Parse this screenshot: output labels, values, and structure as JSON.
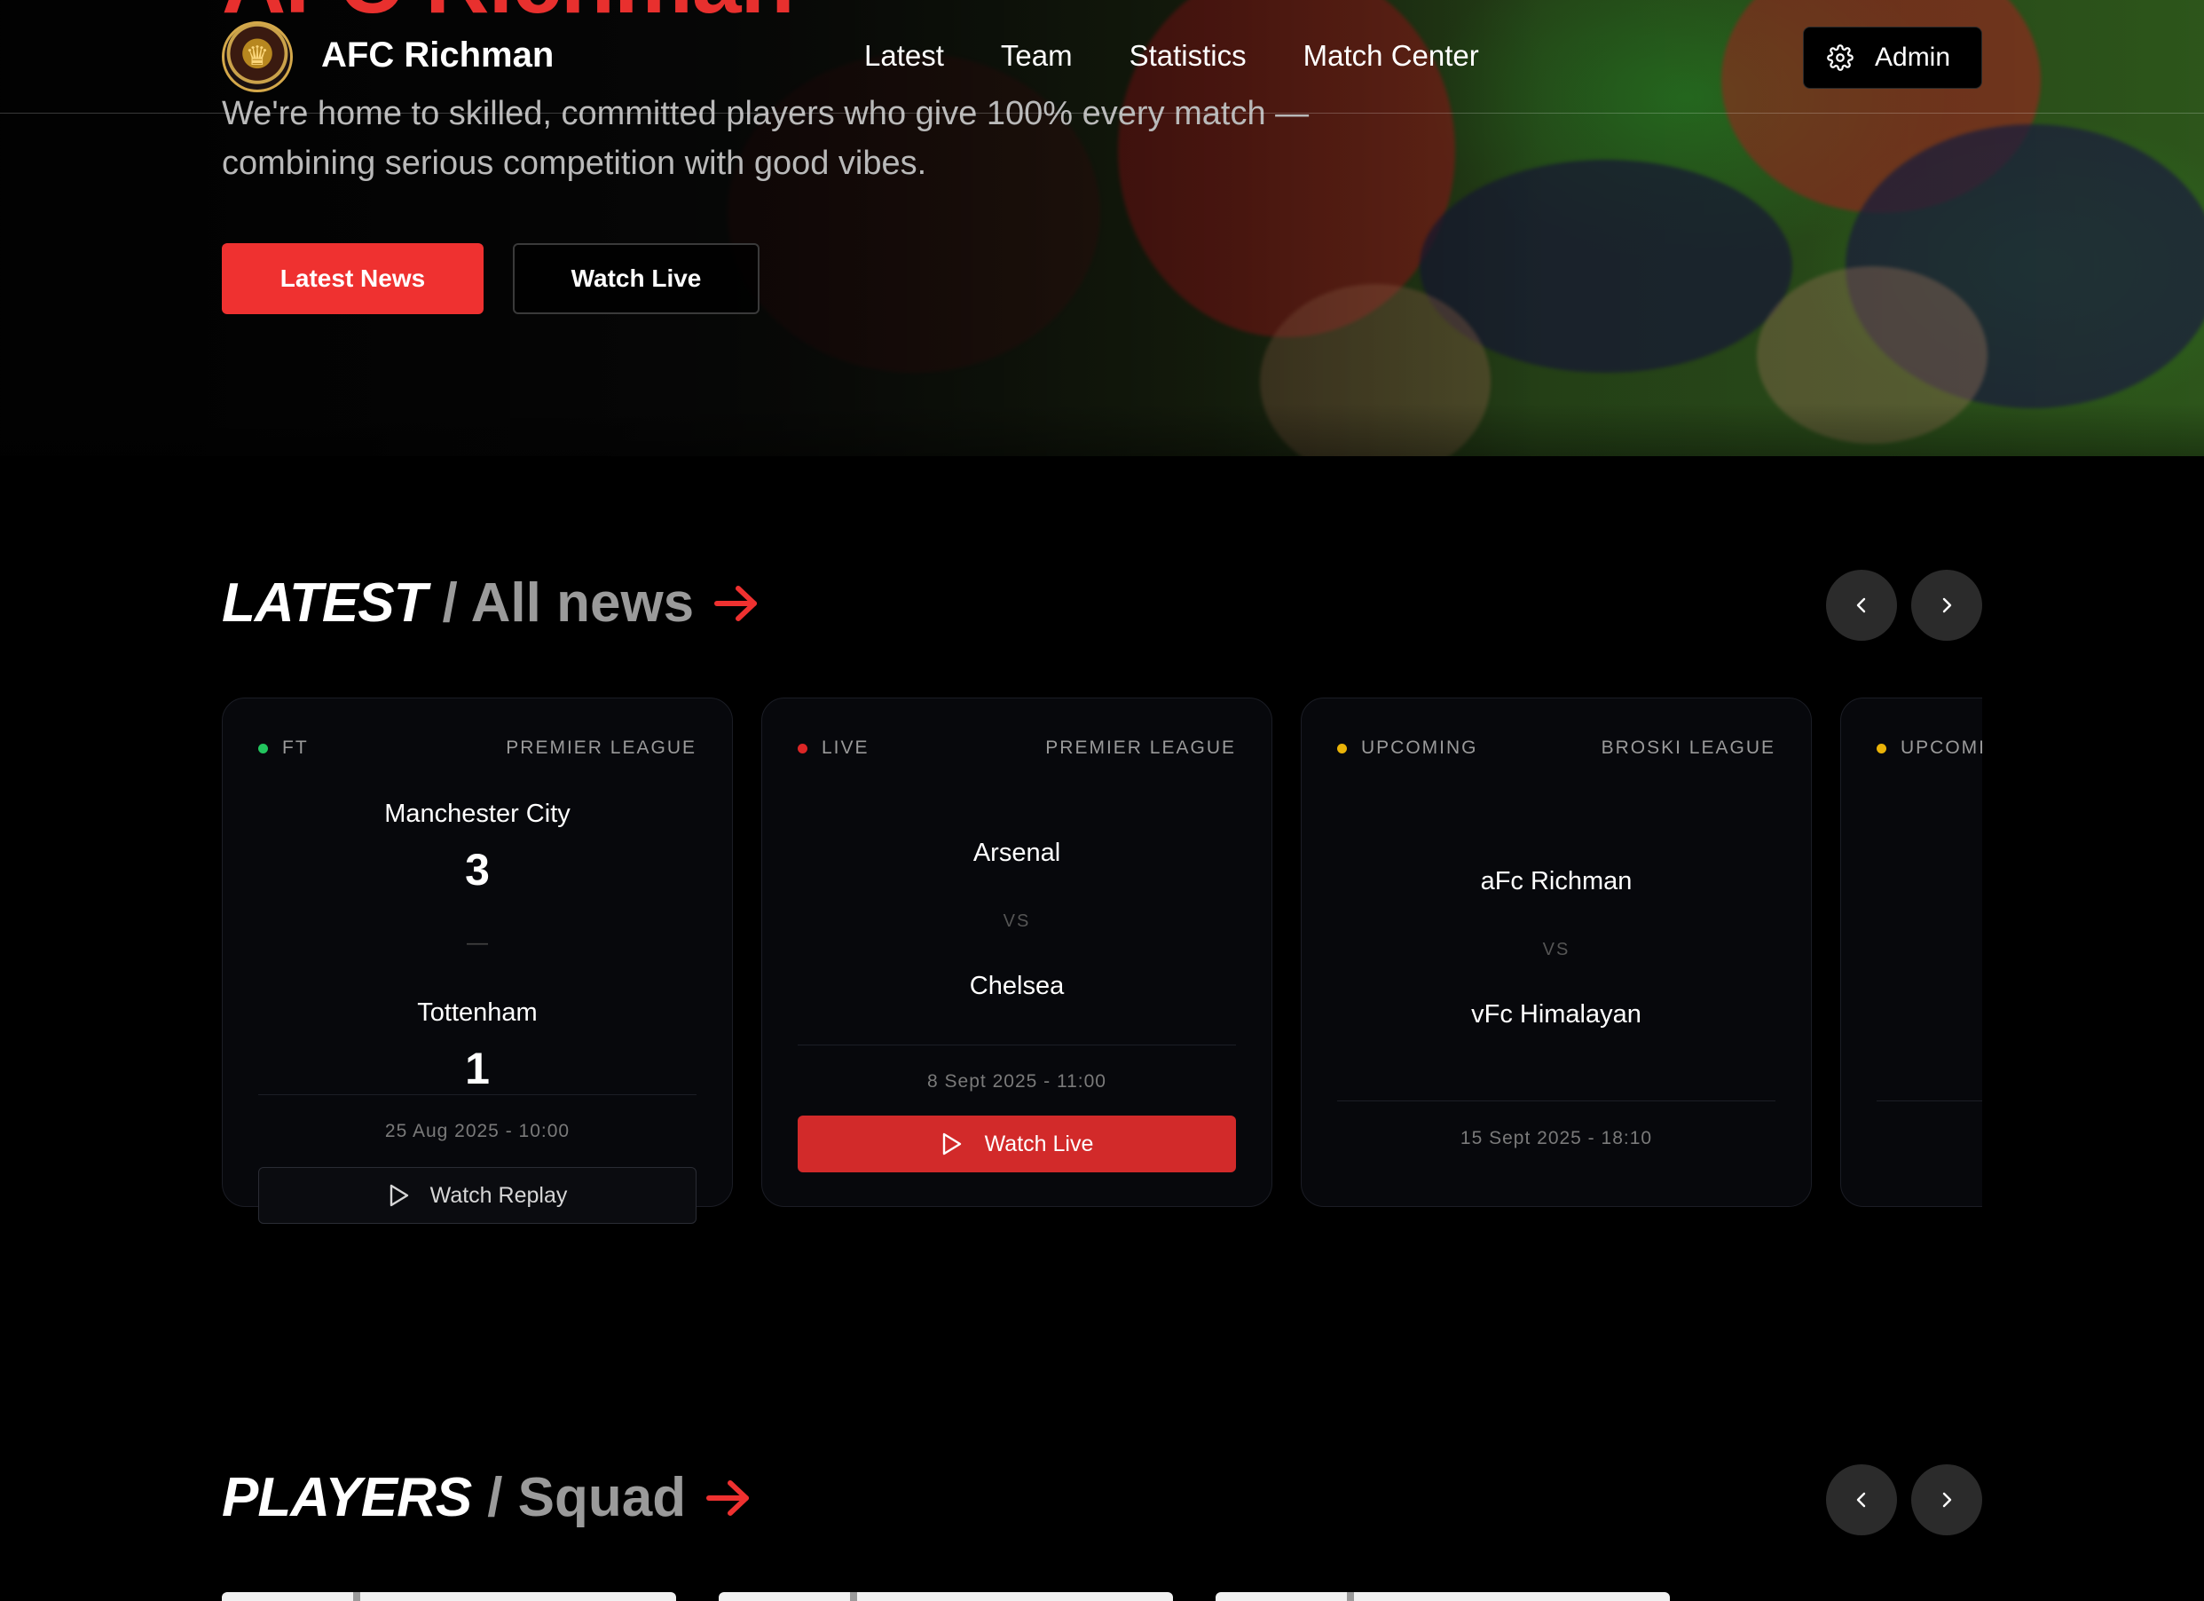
{
  "hero": {
    "title": "AFC Richman",
    "description": "We're home to skilled, committed players who give 100% every match — combining serious competition with good vibes.",
    "primary_button": "Latest News",
    "secondary_button": "Watch Live"
  },
  "nav": {
    "brand": "AFC Richman",
    "links": [
      "Latest",
      "Team",
      "Statistics",
      "Match Center"
    ],
    "admin_label": "Admin"
  },
  "latest": {
    "heading_bold": "LATEST",
    "heading_muted": "/ All news"
  },
  "matches": [
    {
      "status": "FT",
      "status_color": "#22c55e",
      "league": "PREMIER LEAGUE",
      "home": "Manchester City",
      "home_score": "3",
      "separator": "—",
      "away": "Tottenham",
      "away_score": "1",
      "date": "25 Aug 2025 - 10:00",
      "action": "Watch Replay"
    },
    {
      "status": "LIVE",
      "status_color": "#dc2626",
      "league": "PREMIER LEAGUE",
      "home": "Arsenal",
      "vs": "VS",
      "away": "Chelsea",
      "date": "8 Sept 2025 - 11:00",
      "action": "Watch Live"
    },
    {
      "status": "UPCOMING",
      "status_color": "#eab308",
      "league": "BROSKI LEAGUE",
      "home": "aFc Richman",
      "vs": "VS",
      "away": "vFc Himalayan",
      "date": "15 Sept 2025 - 18:10"
    },
    {
      "status": "UPCOMING",
      "status_color": "#eab308"
    }
  ],
  "players": {
    "heading_bold": "PLAYERS",
    "heading_muted": "/ Squad"
  },
  "colors": {
    "accent": "#ef3130",
    "background": "#000000",
    "card": "#07080c"
  },
  "icons": {
    "settings": "gear-icon",
    "prev": "chevron-left-icon",
    "next": "chevron-right-icon",
    "arrow": "arrow-right-icon",
    "play": "play-icon"
  }
}
